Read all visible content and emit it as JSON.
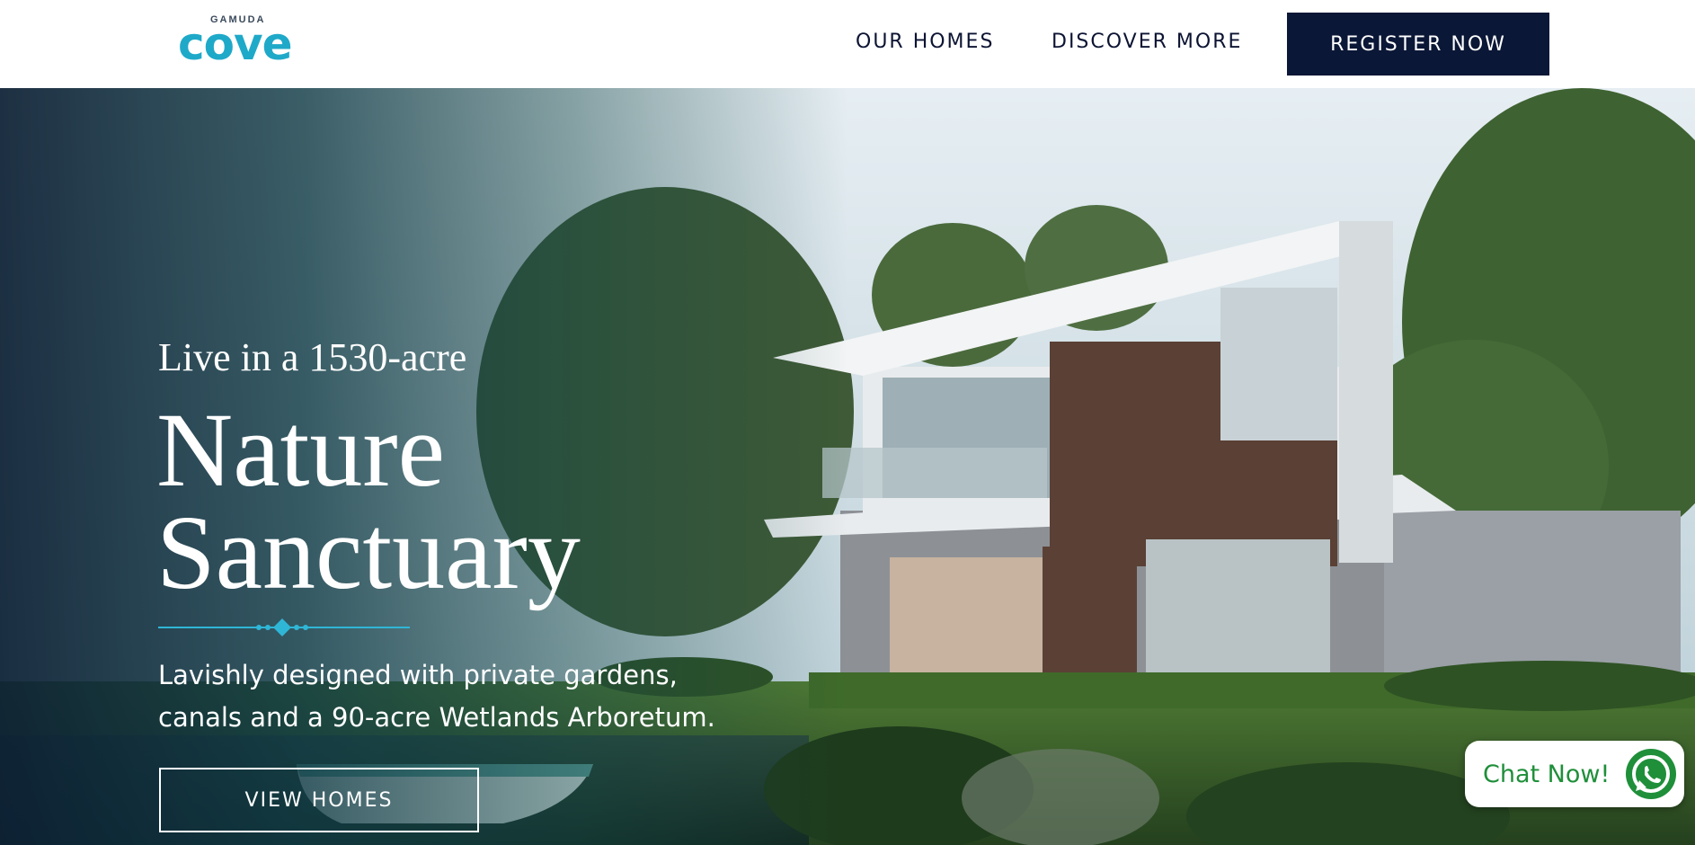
{
  "header": {
    "logo": {
      "small": "GAMUDA",
      "big": "cove"
    },
    "nav": [
      {
        "label": "OUR HOMES"
      },
      {
        "label": "DISCOVER MORE"
      }
    ],
    "cta": "REGISTER NOW"
  },
  "hero": {
    "eyebrow": "Live in a 1530-acre",
    "headline_line1": "Nature",
    "headline_line2": "Sanctuary",
    "description_line1": "Lavishly designed with private gardens,",
    "description_line2": "canals and a 90-acre Wetlands Arboretum.",
    "button": "VIEW HOMES"
  },
  "chat": {
    "label": "Chat Now!",
    "icon": "whatsapp-icon"
  },
  "colors": {
    "navy": "#0b1736",
    "logo_teal": "#1fa9c9",
    "chat_green": "#1f8f3a",
    "divider_teal": "#2fb6d6"
  }
}
